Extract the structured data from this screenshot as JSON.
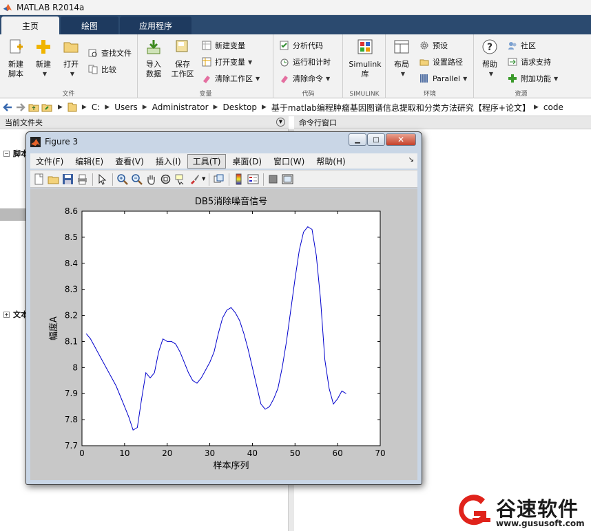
{
  "app": {
    "title": "MATLAB R2014a"
  },
  "tabs": [
    "主页",
    "绘图",
    "应用程序"
  ],
  "ribbon": {
    "file": {
      "label": "文件",
      "new_script": "新建\n脚本",
      "new": "新建",
      "open": "打开",
      "find_files": "查找文件",
      "compare": "比较"
    },
    "variable": {
      "label": "变量",
      "import_data": "导入\n数据",
      "save_workspace": "保存\n工作区",
      "new_variable": "新建变量",
      "open_variable": "打开变量",
      "clear_workspace": "清除工作区"
    },
    "code": {
      "label": "代码",
      "analyze_code": "分析代码",
      "run_and_time": "运行和计时",
      "clear_commands": "清除命令"
    },
    "simulink": {
      "label": "SIMULINK",
      "library": "Simulink\n库"
    },
    "environment": {
      "label": "环境",
      "layout": "布局",
      "preferences": "预设",
      "set_path": "设置路径",
      "parallel": "Parallel"
    },
    "resources": {
      "label": "资源",
      "help": "帮助",
      "community": "社区",
      "request_support": "请求支持",
      "add_ons": "附加功能"
    }
  },
  "address": {
    "crumbs": [
      "C:",
      "Users",
      "Administrator",
      "Desktop",
      "基于matlab编程肿瘤基因图谱信息提取和分类方法研究【程序+论文】",
      "code"
    ]
  },
  "panes": {
    "current_folder": "当前文件夹",
    "command_window": "命令行窗口",
    "tree_item_1": "脚本",
    "tree_item_2": "文本"
  },
  "figure": {
    "title": "Figure 3",
    "menus": [
      "文件(F)",
      "编辑(E)",
      "查看(V)",
      "插入(I)",
      "工具(T)",
      "桌面(D)",
      "窗口(W)",
      "帮助(H)"
    ],
    "highlighted_menu": 4,
    "toolbar_icons": [
      "new-figure-icon",
      "open-file-icon",
      "save-icon",
      "print-icon",
      "edit-plot-icon",
      "zoom-in-icon",
      "zoom-out-icon",
      "pan-icon",
      "rotate-3d-icon",
      "data-cursor-icon",
      "brush-icon",
      "link-plot-icon",
      "insert-colorbar-icon",
      "insert-legend-icon",
      "hide-plot-tools-icon",
      "show-plot-tools-icon"
    ]
  },
  "chart_data": {
    "type": "line",
    "title": "DB5消除噪音信号",
    "xlabel": "样本序列",
    "ylabel": "幅度A",
    "xlim": [
      0,
      70
    ],
    "ylim": [
      7.7,
      8.6
    ],
    "xticks": [
      0,
      10,
      20,
      30,
      40,
      50,
      60,
      70
    ],
    "yticks": [
      7.7,
      7.8,
      7.9,
      8.0,
      8.1,
      8.2,
      8.3,
      8.4,
      8.5,
      8.6
    ],
    "ytick_labels": [
      "7.7",
      "7.8",
      "7.9",
      "8",
      "8.1",
      "8.2",
      "8.3",
      "8.4",
      "8.5",
      "8.6"
    ],
    "grid": false,
    "series": [
      {
        "color": "#0000cc",
        "x": [
          1,
          2,
          3,
          4,
          5,
          6,
          7,
          8,
          9,
          10,
          11,
          12,
          13,
          14,
          15,
          16,
          17,
          18,
          19,
          20,
          21,
          22,
          23,
          24,
          25,
          26,
          27,
          28,
          29,
          30,
          31,
          32,
          33,
          34,
          35,
          36,
          37,
          38,
          39,
          40,
          41,
          42,
          43,
          44,
          45,
          46,
          47,
          48,
          49,
          50,
          51,
          52,
          53,
          54,
          55,
          56,
          57,
          58,
          59,
          60,
          61,
          62
        ],
        "y": [
          8.13,
          8.11,
          8.08,
          8.05,
          8.02,
          7.99,
          7.96,
          7.93,
          7.89,
          7.85,
          7.81,
          7.76,
          7.77,
          7.88,
          7.98,
          7.96,
          7.98,
          8.06,
          8.11,
          8.1,
          8.1,
          8.09,
          8.06,
          8.02,
          7.98,
          7.95,
          7.94,
          7.96,
          7.99,
          8.02,
          8.06,
          8.13,
          8.19,
          8.22,
          8.23,
          8.21,
          8.18,
          8.13,
          8.07,
          8.0,
          7.93,
          7.86,
          7.84,
          7.85,
          7.88,
          7.92,
          8.0,
          8.1,
          8.22,
          8.34,
          8.45,
          8.52,
          8.54,
          8.53,
          8.43,
          8.26,
          8.03,
          7.92,
          7.86,
          7.88,
          7.91,
          7.9
        ]
      }
    ]
  },
  "watermark": {
    "name": "谷速软件",
    "url": "www.gususoft.com"
  }
}
